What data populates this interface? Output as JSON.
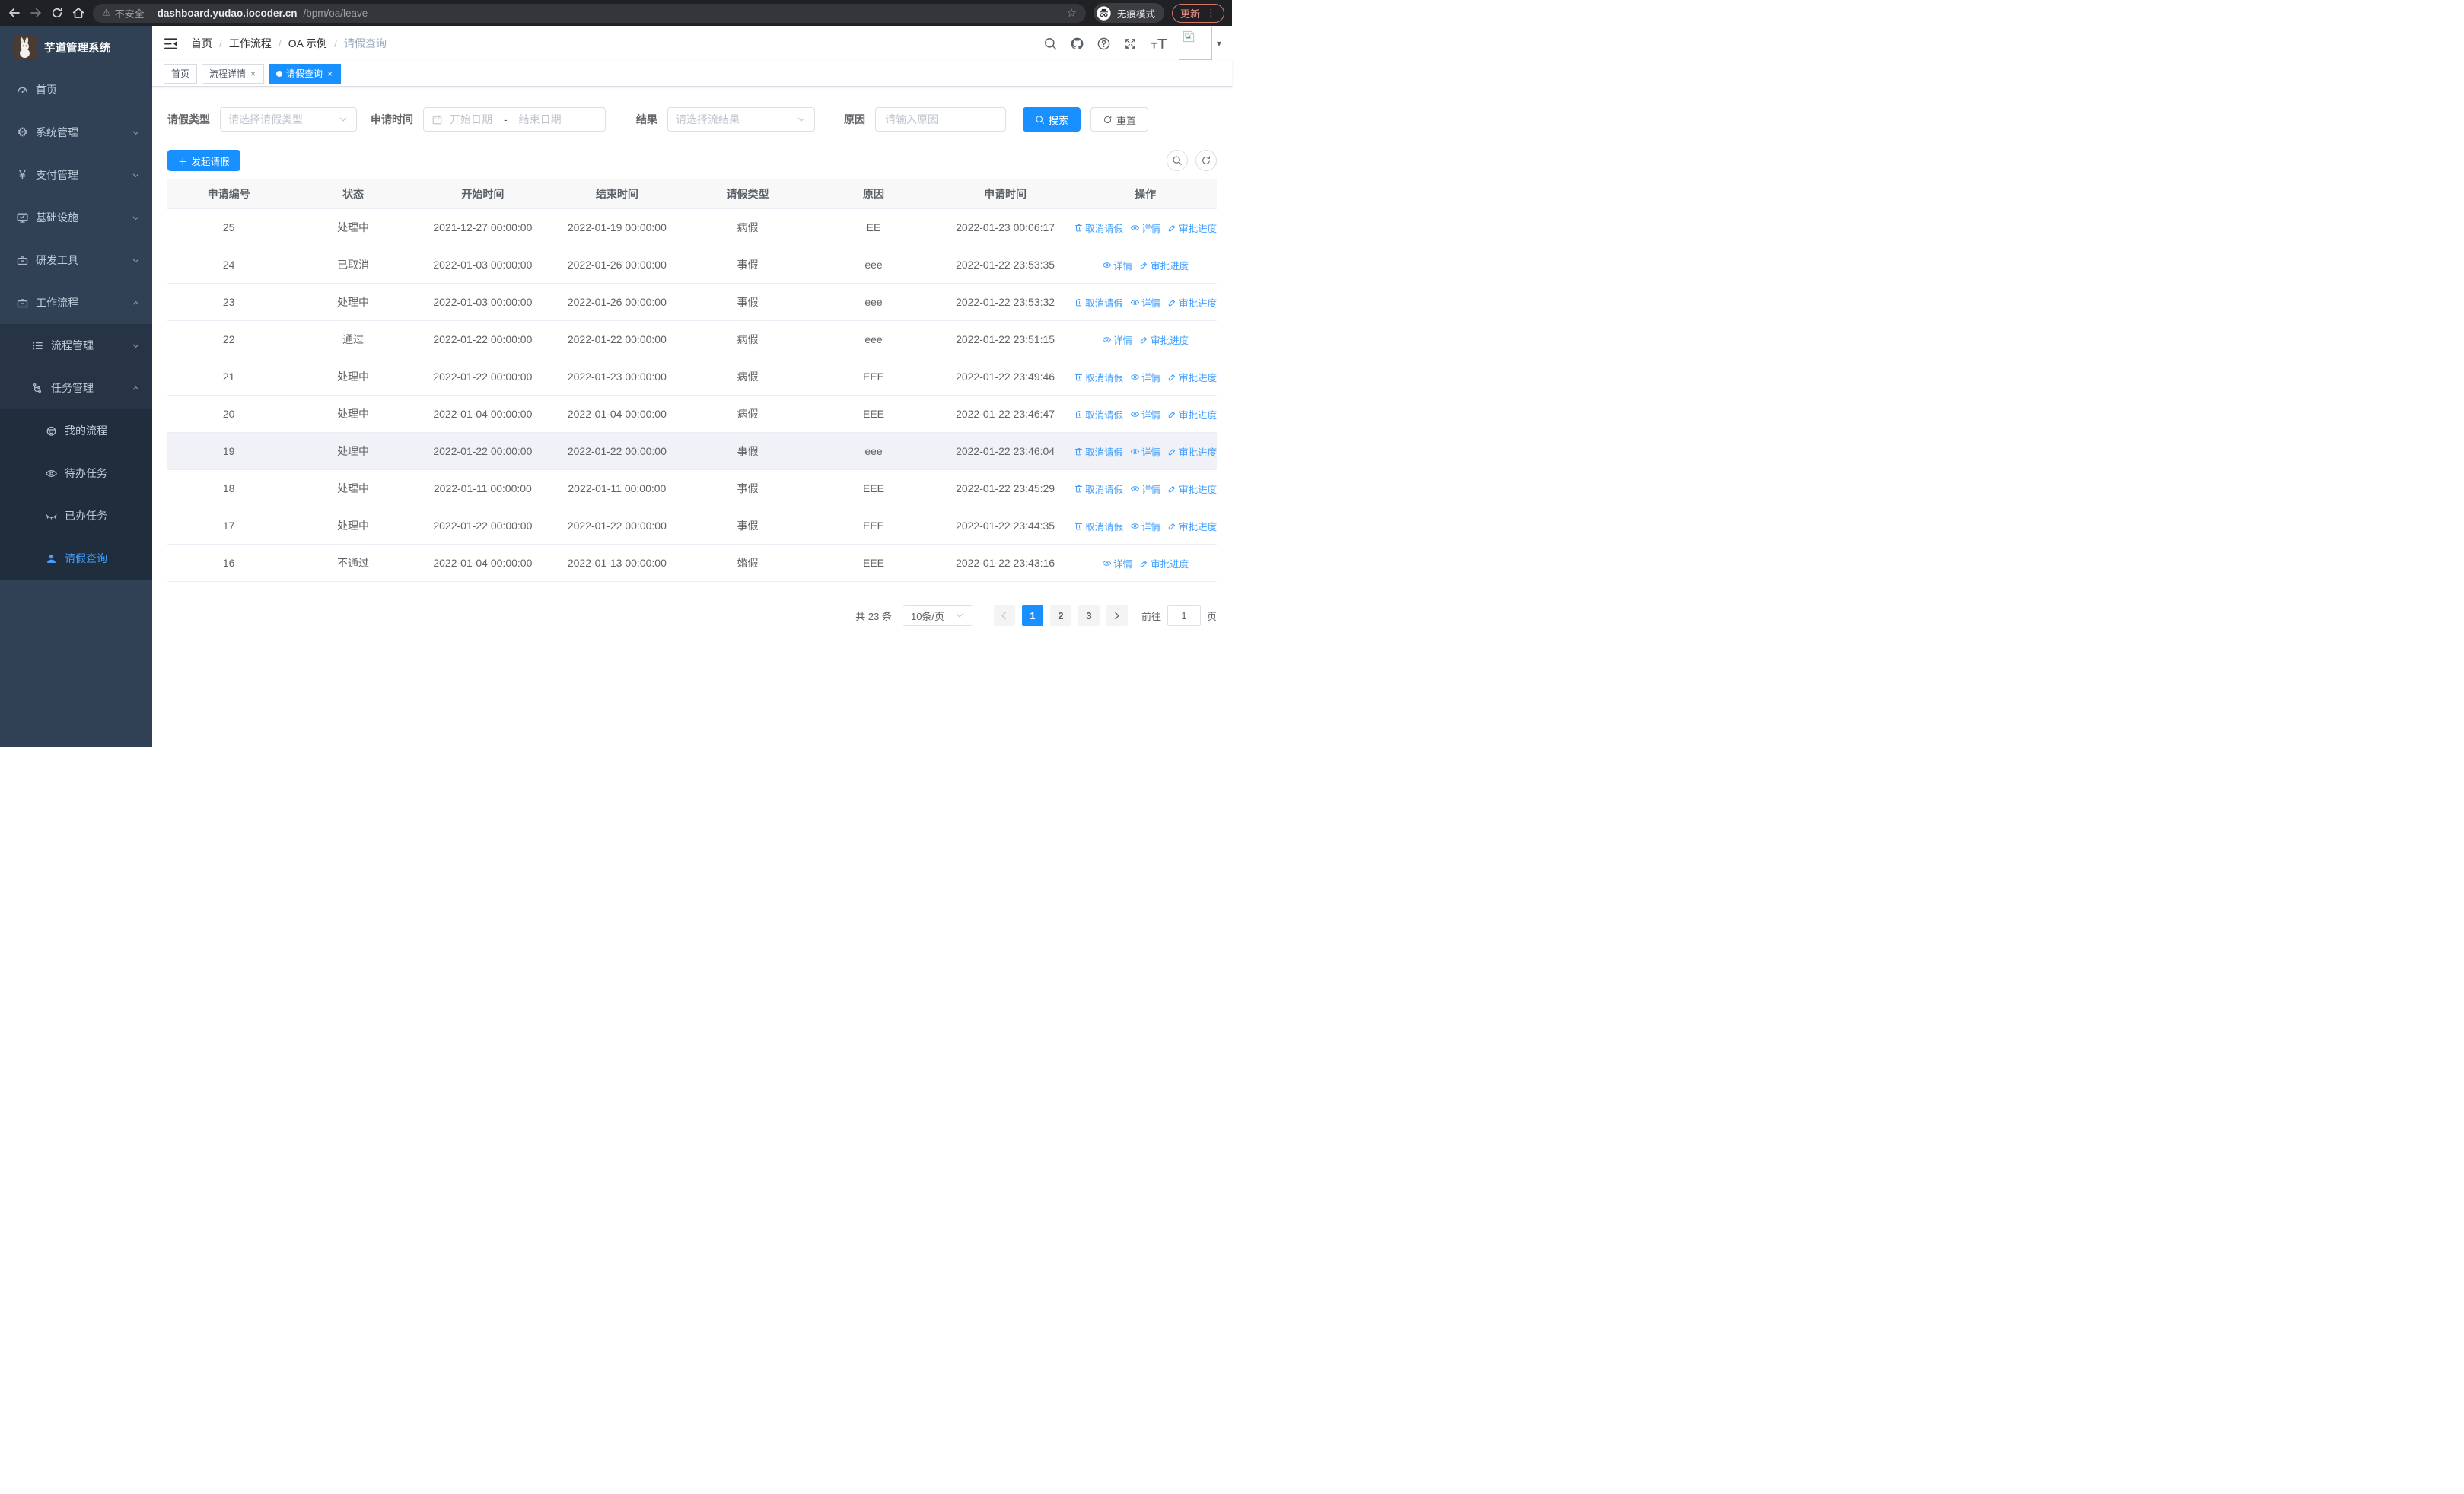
{
  "browser": {
    "security_warning": "不安全",
    "url_host": "dashboard.yudao.iocoder.cn",
    "url_path": "/bpm/oa/leave",
    "incognito_label": "无痕模式",
    "update_label": "更新"
  },
  "sidebar": {
    "title": "芋道管理系统",
    "items": [
      {
        "label": "首页",
        "icon": "gauge-icon",
        "level": 1,
        "chevron": null,
        "active": false
      },
      {
        "label": "系统管理",
        "icon": "gear-icon",
        "level": 1,
        "chevron": "down",
        "active": false
      },
      {
        "label": "支付管理",
        "icon": "yen-icon",
        "level": 1,
        "chevron": "down",
        "active": false
      },
      {
        "label": "基础设施",
        "icon": "monitor-icon",
        "level": 1,
        "chevron": "down",
        "active": false
      },
      {
        "label": "研发工具",
        "icon": "briefcase-icon",
        "level": 1,
        "chevron": "down",
        "active": false
      },
      {
        "label": "工作流程",
        "icon": "briefcase-icon",
        "level": 1,
        "chevron": "up",
        "active": false
      },
      {
        "label": "流程管理",
        "icon": "list-icon",
        "level": 2,
        "chevron": "down",
        "active": false
      },
      {
        "label": "任务管理",
        "icon": "flow-icon",
        "level": 2,
        "chevron": "up",
        "active": false
      },
      {
        "label": "我的流程",
        "icon": "robot-icon",
        "level": 3,
        "chevron": null,
        "active": false
      },
      {
        "label": "待办任务",
        "icon": "eye-icon",
        "level": 3,
        "chevron": null,
        "active": false
      },
      {
        "label": "已办任务",
        "icon": "eye-closed-icon",
        "level": 3,
        "chevron": null,
        "active": false
      },
      {
        "label": "请假查询",
        "icon": "user-icon",
        "level": 3,
        "chevron": null,
        "active": true
      }
    ]
  },
  "header": {
    "breadcrumb": [
      "首页",
      "工作流程",
      "OA 示例",
      "请假查询"
    ]
  },
  "tabs": [
    {
      "label": "首页",
      "closable": false,
      "active": false
    },
    {
      "label": "流程详情",
      "closable": true,
      "active": false
    },
    {
      "label": "请假查询",
      "closable": true,
      "active": true
    }
  ],
  "filters": {
    "leave_type_label": "请假类型",
    "leave_type_placeholder": "请选择请假类型",
    "apply_time_label": "申请时间",
    "start_date_placeholder": "开始日期",
    "range_separator": "-",
    "end_date_placeholder": "结束日期",
    "result_label": "结果",
    "result_placeholder": "请选择流结果",
    "reason_label": "原因",
    "reason_placeholder": "请输入原因",
    "search_label": "搜索",
    "reset_label": "重置"
  },
  "toolbar": {
    "create_label": "发起请假"
  },
  "table": {
    "columns": [
      "申请编号",
      "状态",
      "开始时间",
      "结束时间",
      "请假类型",
      "原因",
      "申请时间",
      "操作"
    ],
    "rows": [
      {
        "id": "25",
        "status": "处理中",
        "start": "2021-12-27 00:00:00",
        "end": "2022-01-19 00:00:00",
        "type": "病假",
        "reason": "EE",
        "apply": "2022-01-23 00:06:17",
        "actions": [
          "cancel",
          "detail",
          "progress"
        ],
        "highlight": false
      },
      {
        "id": "24",
        "status": "已取消",
        "start": "2022-01-03 00:00:00",
        "end": "2022-01-26 00:00:00",
        "type": "事假",
        "reason": "eee",
        "apply": "2022-01-22 23:53:35",
        "actions": [
          "detail",
          "progress"
        ],
        "highlight": false
      },
      {
        "id": "23",
        "status": "处理中",
        "start": "2022-01-03 00:00:00",
        "end": "2022-01-26 00:00:00",
        "type": "事假",
        "reason": "eee",
        "apply": "2022-01-22 23:53:32",
        "actions": [
          "cancel",
          "detail",
          "progress"
        ],
        "highlight": false
      },
      {
        "id": "22",
        "status": "通过",
        "start": "2022-01-22 00:00:00",
        "end": "2022-01-22 00:00:00",
        "type": "病假",
        "reason": "eee",
        "apply": "2022-01-22 23:51:15",
        "actions": [
          "detail",
          "progress"
        ],
        "highlight": false
      },
      {
        "id": "21",
        "status": "处理中",
        "start": "2022-01-22 00:00:00",
        "end": "2022-01-23 00:00:00",
        "type": "病假",
        "reason": "EEE",
        "apply": "2022-01-22 23:49:46",
        "actions": [
          "cancel",
          "detail",
          "progress"
        ],
        "highlight": false
      },
      {
        "id": "20",
        "status": "处理中",
        "start": "2022-01-04 00:00:00",
        "end": "2022-01-04 00:00:00",
        "type": "病假",
        "reason": "EEE",
        "apply": "2022-01-22 23:46:47",
        "actions": [
          "cancel",
          "detail",
          "progress"
        ],
        "highlight": false
      },
      {
        "id": "19",
        "status": "处理中",
        "start": "2022-01-22 00:00:00",
        "end": "2022-01-22 00:00:00",
        "type": "事假",
        "reason": "eee",
        "apply": "2022-01-22 23:46:04",
        "actions": [
          "cancel",
          "detail",
          "progress"
        ],
        "highlight": true
      },
      {
        "id": "18",
        "status": "处理中",
        "start": "2022-01-11 00:00:00",
        "end": "2022-01-11 00:00:00",
        "type": "事假",
        "reason": "EEE",
        "apply": "2022-01-22 23:45:29",
        "actions": [
          "cancel",
          "detail",
          "progress"
        ],
        "highlight": false
      },
      {
        "id": "17",
        "status": "处理中",
        "start": "2022-01-22 00:00:00",
        "end": "2022-01-22 00:00:00",
        "type": "事假",
        "reason": "EEE",
        "apply": "2022-01-22 23:44:35",
        "actions": [
          "cancel",
          "detail",
          "progress"
        ],
        "highlight": false
      },
      {
        "id": "16",
        "status": "不通过",
        "start": "2022-01-04 00:00:00",
        "end": "2022-01-13 00:00:00",
        "type": "婚假",
        "reason": "EEE",
        "apply": "2022-01-22 23:43:16",
        "actions": [
          "detail",
          "progress"
        ],
        "highlight": false
      }
    ]
  },
  "actions": {
    "cancel": "取消请假",
    "detail": "详情",
    "progress": "审批进度"
  },
  "pagination": {
    "total_label": "共 23 条",
    "page_size": "10条/页",
    "pages": [
      "1",
      "2",
      "3"
    ],
    "active_page": "1",
    "goto_label": "前往",
    "goto_value": "1",
    "unit_label": "页"
  },
  "colors": {
    "accent": "#1890ff",
    "link": "#409eff",
    "sidebar_bg": "#304156",
    "submenu_bg": "#263445",
    "submenu_deep_bg": "#1f2d3d"
  }
}
